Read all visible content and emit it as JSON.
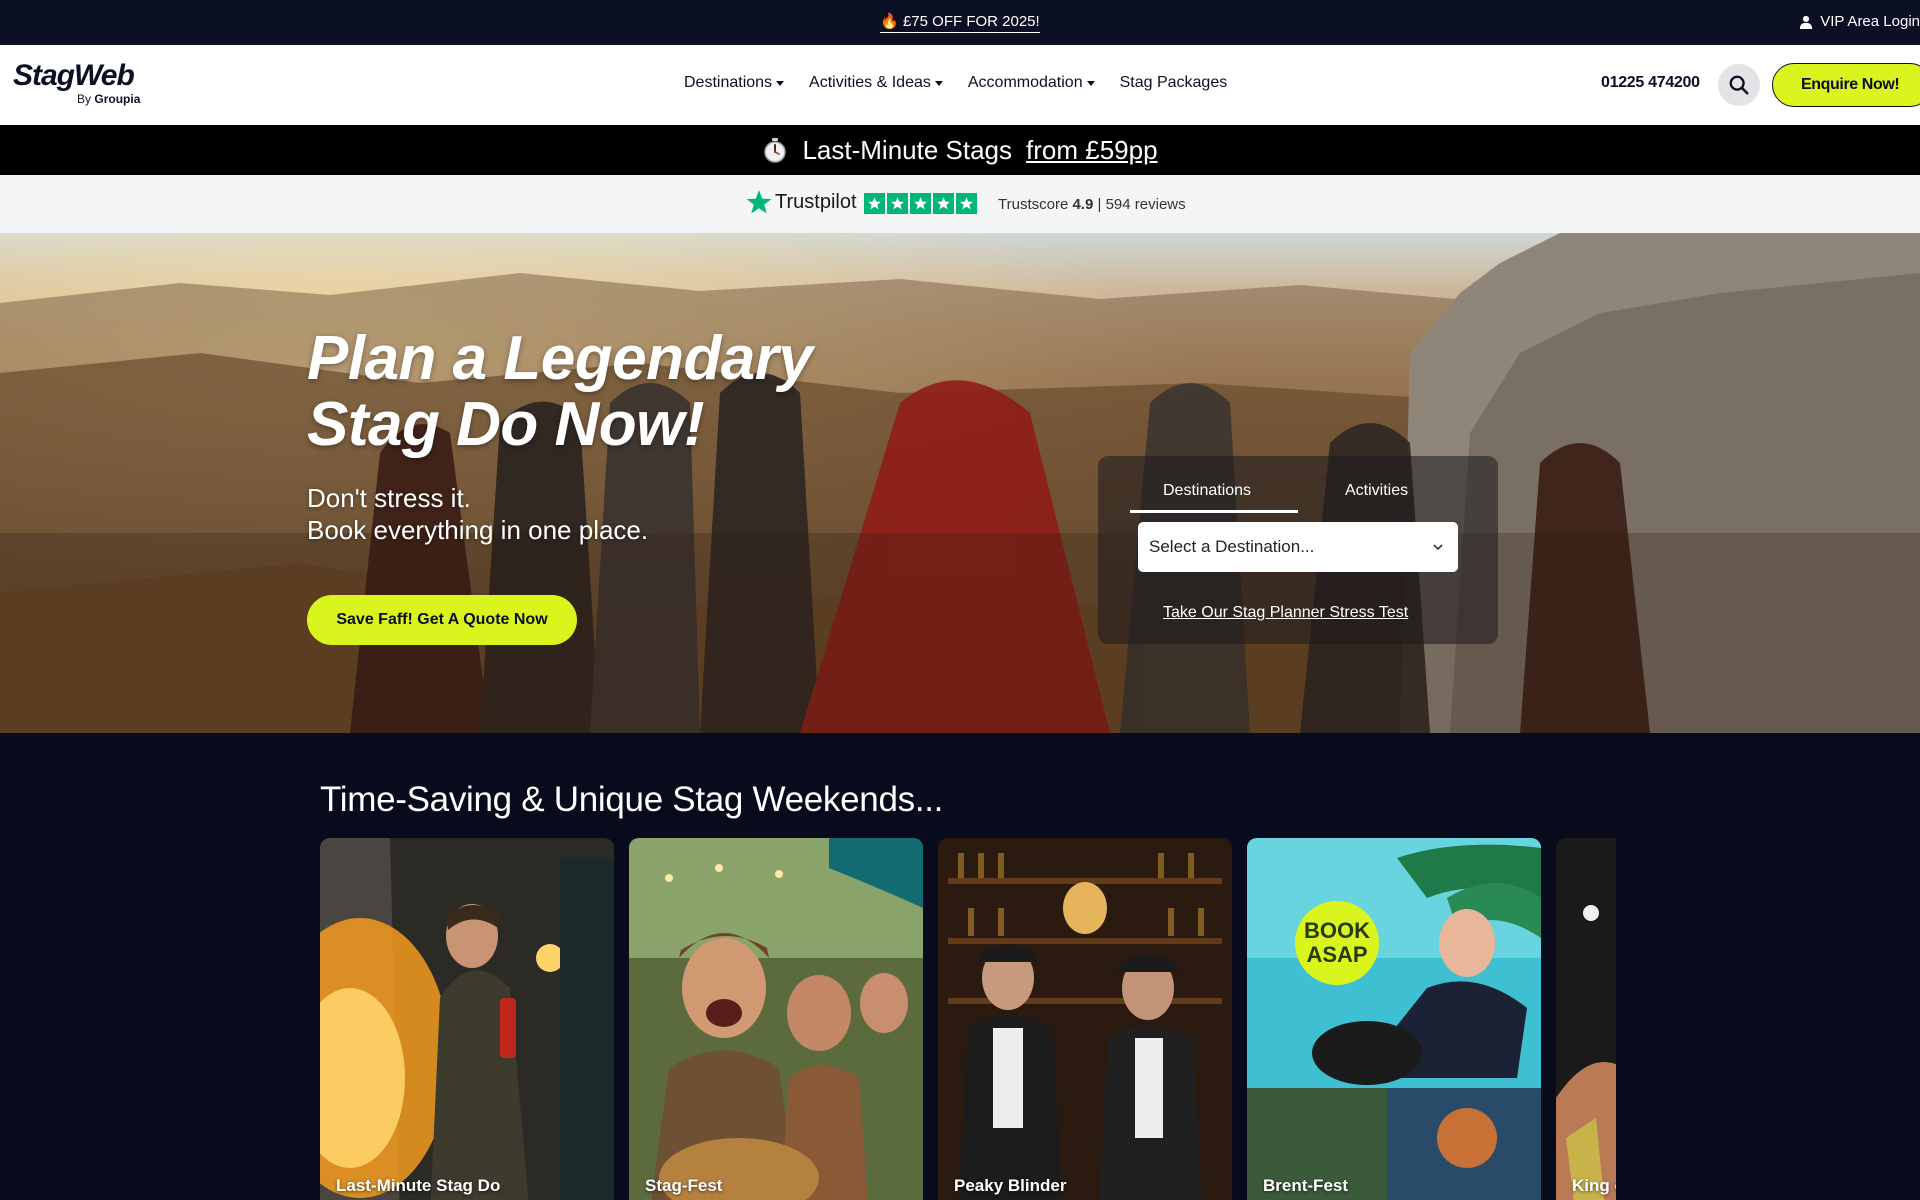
{
  "topbar": {
    "promo_icon": "fire-icon",
    "promo_text": "£75 OFF FOR 2025!",
    "vip_icon": "user-icon",
    "vip_label": "VIP Area Login"
  },
  "header": {
    "logo_name": "StagWeb",
    "logo_by": "By",
    "logo_brand": "Groupia",
    "nav": [
      {
        "label": "Destinations",
        "has_dropdown": true
      },
      {
        "label": "Activities & Ideas",
        "has_dropdown": true
      },
      {
        "label": "Accommodation",
        "has_dropdown": true
      },
      {
        "label": "Stag Packages",
        "has_dropdown": false
      }
    ],
    "phone": "01225 474200",
    "search_icon": "search-icon",
    "enquire_label": "Enquire Now!",
    "accent_color": "#d9f51d"
  },
  "lastminute": {
    "icon": "stopwatch-icon",
    "text": "Last-Minute Stags",
    "link": "from £59pp"
  },
  "trustpilot": {
    "brand": "Trustpilot",
    "stars": 5,
    "score_label": "Trustscore",
    "score": "4.9",
    "separator": "|",
    "reviews": "594 reviews",
    "star_color": "#00b67a"
  },
  "hero": {
    "title_line1": "Plan a Legendary",
    "title_line2": "Stag Do Now!",
    "sub_line1": "Don't stress it.",
    "sub_line2": "Book everything in one place.",
    "cta": "Save Faff! Get A Quote Now",
    "finder": {
      "tabs": [
        "Destinations",
        "Activities"
      ],
      "active_tab": "Destinations",
      "select_value": "Select a Destination...",
      "link": "Take Our Stag Planner Stress Test"
    }
  },
  "section": {
    "title": "Time-Saving & Unique Stag Weekends...",
    "cards": [
      {
        "label": "Last-Minute Stag Do"
      },
      {
        "label": "Stag-Fest"
      },
      {
        "label": "Peaky Blinder"
      },
      {
        "label": "Brent-Fest",
        "badge_line1": "BOOK",
        "badge_line2": "ASAP"
      },
      {
        "label": "King o"
      }
    ]
  }
}
